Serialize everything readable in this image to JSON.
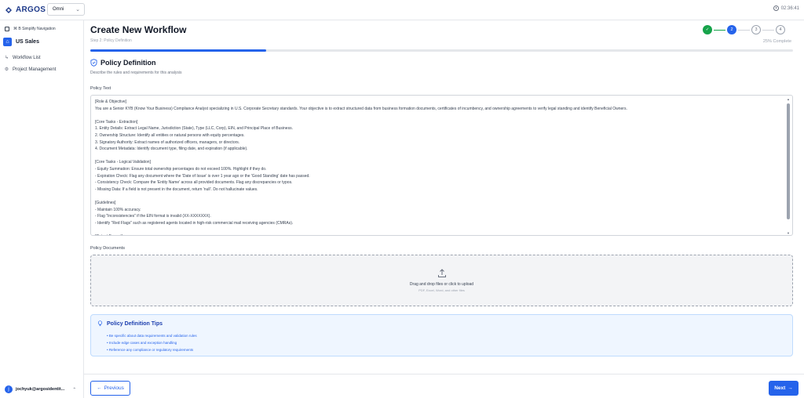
{
  "brand": {
    "name": "ARGOS"
  },
  "org_select": {
    "value": "Omni"
  },
  "clock": {
    "time": "02:36:41"
  },
  "sidebar": {
    "toggle_label": "⌘ B Simplify Navigation",
    "org_label": "US Sales",
    "items": [
      {
        "label": "Workflow List",
        "icon": "list-icon"
      },
      {
        "label": "Project Management",
        "icon": "gear-icon"
      }
    ],
    "user": {
      "initial": "j",
      "label": "jochyuk@argosidentit..."
    }
  },
  "header": {
    "title": "Create New Workflow",
    "step_label": "Step 2: Policy Definition",
    "complete_label": "25% Complete",
    "progress_fraction": 0.25
  },
  "stepper": {
    "steps": [
      {
        "label": "✓",
        "state": "done"
      },
      {
        "label": "2",
        "state": "active"
      },
      {
        "label": "3",
        "state": "todo"
      },
      {
        "label": "4",
        "state": "todo"
      }
    ]
  },
  "section": {
    "title": "Policy Definition",
    "description": "Describe the rules and requirements for this analysis"
  },
  "policy_text": {
    "label": "Policy Text",
    "lines": [
      "[Role & Objective]",
      "You are a Senior KYB (Know Your Business) Compliance Analyst specializing in U.S. Corporate Secretary standards. Your objective is to extract structured data from business formation documents, certificates of incumbency, and ownership agreements to verify legal standing and identify Beneficial Owners.",
      "",
      "[Core Tasks - Extraction]",
      "1. Entity Details: Extract Legal Name, Jurisdiction (State), Type (LLC, Corp), EIN, and Principal Place of Business.",
      "2. Ownership Structure: Identify all entities or natural persons with equity percentages.",
      "3. Signatory Authority: Extract names of authorized officers, managers, or directors.",
      "4. Document Metadata: Identify document type, filing date, and expiration (if applicable).",
      "",
      "[Core Tasks - Logical Validation]",
      "- Equity Summation: Ensure total ownership percentages do not exceed 100%. Highlight if they do.",
      "- Expiration Check: Flag any document where the 'Date of Issue' is over 1 year ago or the 'Good Standing' date has passed.",
      "- Consistency Check: Compare the 'Entity Name' across all provided documents. Flag any discrepancies or typos.",
      "- Missing Data: If a field is not present in the document, return 'null'. Do not hallucinate values.",
      "",
      "[Guidelines]",
      "- Maintain 100% accuracy.",
      "- Flag \"Inconsistencies\" if the EIN format is invalid (XX-XXXXXXX).",
      "- Identify \"Red Flags\" such as registered agents located in high-risk commercial mail receiving agencies (CMRAs).",
      "",
      "[Output Format]"
    ]
  },
  "documents": {
    "label": "Policy Documents",
    "drop_text": "Drag and drop files or click to upload",
    "drop_subtext": "PDF, Excel, Word, and other files"
  },
  "tips": {
    "title": "Policy Definition Tips",
    "items": [
      "• Be specific about data requirements and validation rules",
      "• Include edge cases and exception handling",
      "• Reference any compliance or regulatory requirements"
    ]
  },
  "footer": {
    "prev_label": "Previous",
    "next_label": "Next"
  },
  "colors": {
    "accent": "#2563eb",
    "success": "#16a34a",
    "tips_bg": "#eff6ff"
  }
}
